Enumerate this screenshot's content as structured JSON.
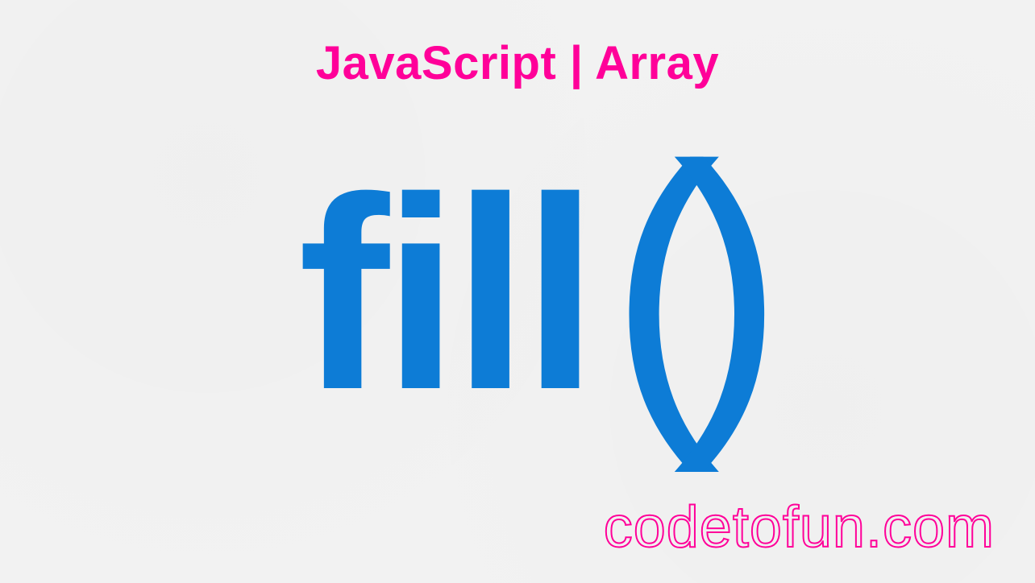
{
  "heading": "JavaScript | Array",
  "main": {
    "word": "fill",
    "parens": "()"
  },
  "watermark": "codetofun.com",
  "colors": {
    "pink": "#ff0099",
    "blue": "#0d7cd6",
    "background": "#f2f2f2"
  }
}
